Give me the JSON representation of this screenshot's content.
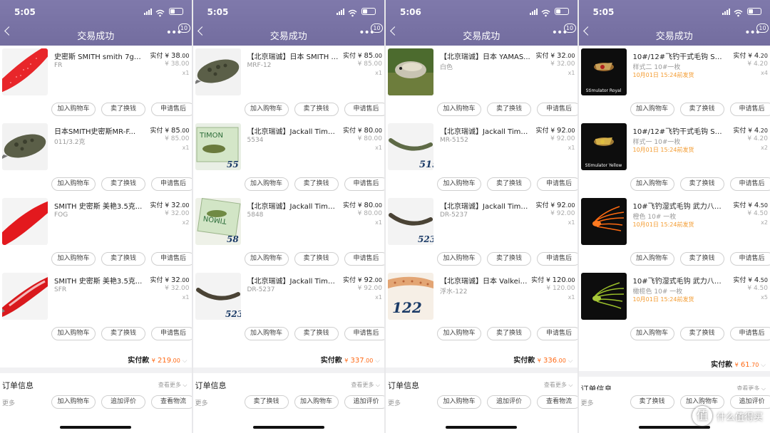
{
  "header": {
    "title": "交易成功",
    "badge": "10"
  },
  "labels": {
    "paid": "实付",
    "currency": "¥",
    "btn_cart": "加入购物车",
    "btn_exchange": "卖了换钱",
    "btn_after": "申请售后",
    "total_label": "实付款",
    "order_info": "订单信息",
    "see_more": "查看更多",
    "more": "更多"
  },
  "watermark": "什么值得买",
  "panels": [
    {
      "time": "5:05",
      "items": [
        {
          "name": "史密斯 SMITH  smith 7g天...",
          "spec": "FR",
          "price": "38",
          "cents": ".00",
          "orig": "¥ 38.00",
          "qty": "x1",
          "thumb": "red-glitter-spoon"
        },
        {
          "name": "日本SMITH史密斯MR-F...",
          "spec": "011/3.2克",
          "price": "85",
          "cents": ".00",
          "orig": "¥ 85.00",
          "qty": "x1",
          "thumb": "olive-crankbait"
        },
        {
          "name": "SMITH 史密斯  美艳3.5克...",
          "spec": "FOG",
          "price": "32",
          "cents": ".00",
          "orig": "¥ 32.00",
          "qty": "x2",
          "thumb": "red-spoon"
        },
        {
          "name": "SMITH 史密斯  美艳3.5克...",
          "spec": "SFR",
          "price": "32",
          "cents": ".00",
          "orig": "¥ 32.00",
          "qty": "x1",
          "thumb": "red-silver-spoon"
        }
      ],
      "total": "219",
      "total_cents": ".00",
      "bottom": [
        "加入购物车",
        "追加评价",
        "查看物流"
      ]
    },
    {
      "time": "5:05",
      "items": [
        {
          "name": "【北京瑞诚】日本 SMITH S...",
          "spec": "MRF-12",
          "price": "85",
          "cents": ".00",
          "orig": "¥ 85.00",
          "qty": "x1",
          "thumb": "olive-crankbait"
        },
        {
          "name": "【北京瑞诚】Jackall Timo...",
          "spec": "5534",
          "price": "80",
          "cents": ".00",
          "orig": "¥ 80.00",
          "qty": "x1",
          "thumb": "timon-box-55"
        },
        {
          "name": "【北京瑞诚】Jackall Timo...",
          "spec": "5848",
          "price": "80",
          "cents": ".00",
          "orig": "¥ 80.00",
          "qty": "x1",
          "thumb": "timon-box-58"
        },
        {
          "name": "【北京瑞诚】Jackall Timo...",
          "spec": "DR-5237",
          "price": "92",
          "cents": ".00",
          "orig": "¥ 92.00",
          "qty": "x1",
          "thumb": "minnow-523"
        }
      ],
      "total": "337",
      "total_cents": ".00",
      "bottom": [
        "卖了换钱",
        "加入购物车",
        "追加评价"
      ]
    },
    {
      "time": "5:06",
      "items": [
        {
          "name": "【北京瑞诚】日本 YAMAS...",
          "spec": "白色",
          "price": "32",
          "cents": ".00",
          "orig": "¥ 32.00",
          "qty": "x1",
          "thumb": "fish-photo"
        },
        {
          "name": "【北京瑞诚】Jackall Timo...",
          "spec": "MR-5152",
          "price": "92",
          "cents": ".00",
          "orig": "¥ 92.00",
          "qty": "x1",
          "thumb": "minnow-515"
        },
        {
          "name": "【北京瑞诚】Jackall Timo...",
          "spec": "DR-5237",
          "price": "92",
          "cents": ".00",
          "orig": "¥ 92.00",
          "qty": "x1",
          "thumb": "minnow-523"
        },
        {
          "name": "【北京瑞诚】日本 Valkein...",
          "spec": "浮水-122",
          "price": "120",
          "cents": ".00",
          "orig": "¥ 120.00",
          "qty": "x1",
          "thumb": "pattern-122"
        }
      ],
      "total": "336",
      "total_cents": ".00",
      "bottom": [
        "加入购物车",
        "追加评价",
        "查看物流"
      ]
    },
    {
      "time": "5:05",
      "items": [
        {
          "name": "10#/12#飞钓干式毛钩 Stimul...",
          "spec": "样式二 10#一枚",
          "ship": "10月01日 15:24前发货",
          "price": "4",
          "cents": ".20",
          "orig": "¥ 4.20",
          "qty": "x4",
          "thumb": "fly-stimulator-royal",
          "caption": "Stimulator Royal"
        },
        {
          "name": "10#/12#飞钓干式毛钩 Stimul...",
          "spec": "样式一 10#一枚",
          "ship": "10月01日 15:24前发货",
          "price": "4",
          "cents": ".20",
          "orig": "¥ 4.20",
          "qty": "x2",
          "thumb": "fly-stimulator-yellow",
          "caption": "Stimulator Yellow"
        },
        {
          "name": "10#飞钓湿式毛钩 武力八哥...",
          "spec": "橙色 10# 一枚",
          "ship": "10月01日 15:24前发货",
          "price": "4",
          "cents": ".50",
          "orig": "¥ 4.50",
          "qty": "x2",
          "thumb": "fly-orange"
        },
        {
          "name": "10#飞钓湿式毛钩 武力八哥...",
          "spec": "橄榄色 10# 一枚",
          "ship": "10月01日 15:24前发货",
          "price": "4",
          "cents": ".50",
          "orig": "¥ 4.50",
          "qty": "x5",
          "thumb": "fly-olive"
        }
      ],
      "total": "61",
      "total_cents": ".70",
      "bottom": [
        "卖了换钱",
        "加入购物车",
        "追加评价"
      ]
    }
  ]
}
